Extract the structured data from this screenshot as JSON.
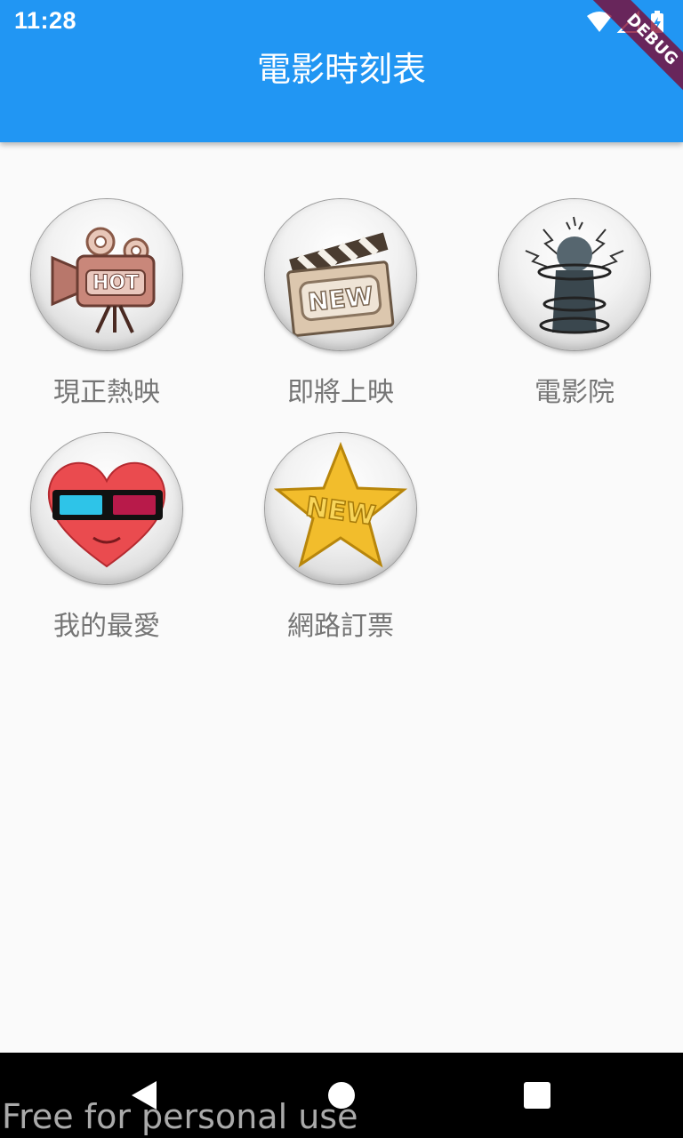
{
  "status_bar": {
    "time": "11:28",
    "icons": [
      "wifi-icon",
      "signal-icon",
      "battery-charging-icon"
    ]
  },
  "app_bar": {
    "title": "電影時刻表",
    "debug_banner": "DEBUG"
  },
  "menu": {
    "items": [
      {
        "label": "現正熱映",
        "icon": "movie-camera-hot-icon",
        "icon_text": "HOT"
      },
      {
        "label": "即將上映",
        "icon": "clapperboard-new-icon",
        "icon_text": "NEW"
      },
      {
        "label": "電影院",
        "icon": "theater-tower-icon"
      },
      {
        "label": "我的最愛",
        "icon": "heart-3d-glasses-icon"
      },
      {
        "label": "網路訂票",
        "icon": "star-new-icon",
        "icon_text": "NEW"
      }
    ]
  },
  "nav_bar": {
    "back": "back-icon",
    "home": "home-icon",
    "recents": "recents-icon"
  },
  "watermark": "Free for personal use",
  "colors": {
    "primary": "#2196f3",
    "label": "#757575",
    "background": "#fafafa",
    "debug": "#800028"
  }
}
